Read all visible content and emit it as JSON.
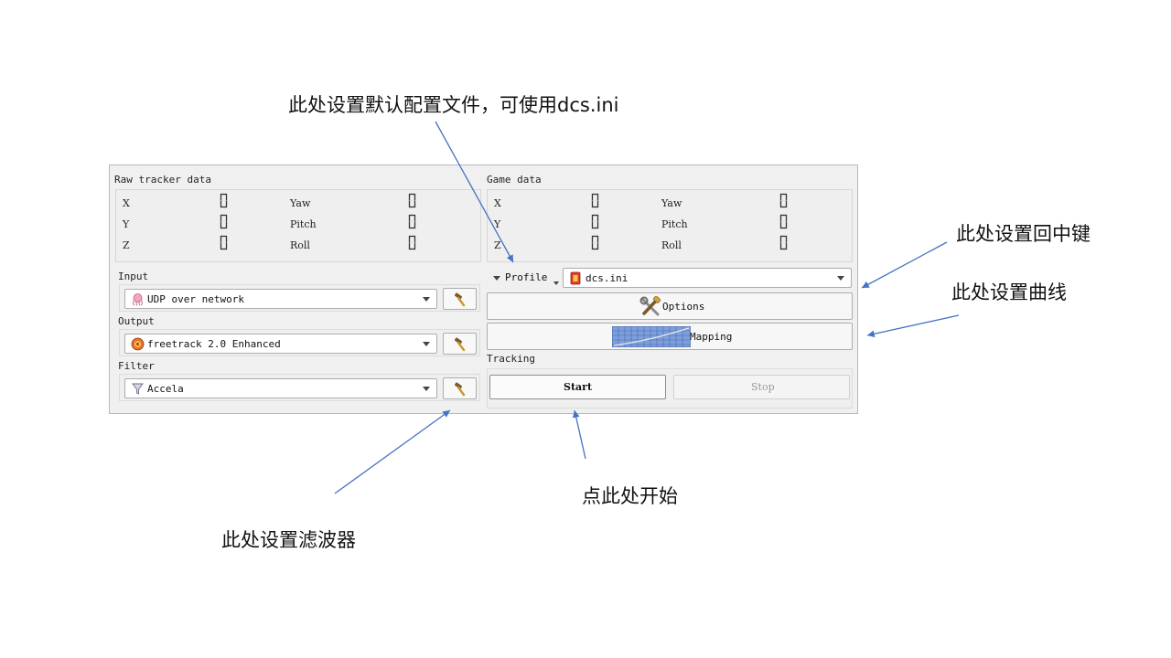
{
  "annotations": {
    "profile_note": "此处设置默认配置文件，可使用dcs.ini",
    "center_key_note": "此处设置回中键",
    "curve_note": "此处设置曲线",
    "start_note": "点此处开始",
    "filter_note": "此处设置滤波器"
  },
  "raw_tracker": {
    "title": "Raw tracker data",
    "rows": [
      {
        "axis": "X",
        "rot": "Yaw"
      },
      {
        "axis": "Y",
        "rot": "Pitch"
      },
      {
        "axis": "Z",
        "rot": "Roll"
      }
    ]
  },
  "game_data": {
    "title": "Game data",
    "rows": [
      {
        "axis": "X",
        "rot": "Yaw"
      },
      {
        "axis": "Y",
        "rot": "Pitch"
      },
      {
        "axis": "Z",
        "rot": "Roll"
      }
    ]
  },
  "lcd_value": "0",
  "input": {
    "label": "Input",
    "value": "UDP over network",
    "icon": "octopus-icon"
  },
  "output": {
    "label": "Output",
    "value": "freetrack 2.0 Enhanced",
    "icon": "freetrack-icon"
  },
  "filter": {
    "label": "Filter",
    "value": "Accela",
    "icon": "funnel-icon"
  },
  "profile": {
    "label": "Profile",
    "value": "dcs.ini",
    "icon": "profile-file-icon"
  },
  "options_label": "Options",
  "mapping_label": "Mapping",
  "tracking": {
    "title": "Tracking",
    "start_label": "Start",
    "stop_label": "Stop"
  },
  "colors": {
    "annotation_arrow": "#4472c4",
    "window_bg": "#f0f0f0",
    "mapping_grid": "#5b7fc7"
  }
}
